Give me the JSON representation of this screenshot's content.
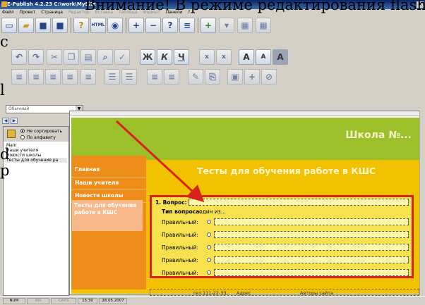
{
  "window": {
    "title": "E-Publish 4.2.23     C:\\work\\MySite"
  },
  "overlay": {
    "line1": "Внимание! В режиме редактирования flash",
    "line2_fragments": [
      "c",
      "l",
      "d",
      "p"
    ]
  },
  "menu": {
    "items": [
      "Файл",
      "Проект",
      "Страница",
      "Редактор",
      "Вставка",
      "Таблица",
      "Формат",
      "Панели",
      "?"
    ],
    "disabled": [
      "Редактор",
      "Вставка",
      "Таблица",
      "Формат"
    ]
  },
  "toolbar": {
    "html_label": "HTML",
    "bold": "Ж",
    "italic": "К",
    "underline": "Ч",
    "subscript": "x",
    "superscript": "x",
    "font_a": "A"
  },
  "style_select": {
    "value": "Обычный"
  },
  "sort": {
    "option1": "Не сортировать",
    "option2": "По алфавиту"
  },
  "pages": [
    "Main",
    "Наши учителя",
    "Новости школы",
    "Тесты для обучения ра"
  ],
  "site": {
    "title": "Школа №...",
    "page_heading": "Тесты для обучения работе в КШС",
    "nav": [
      "Главная",
      "Наши учителя",
      "Новости школы",
      "Тесты для обучения работе в КШС"
    ],
    "question_label": "1. Вопрос:",
    "type_label": "Тип вопроса:",
    "type_value": "один из...",
    "answer_label": "Правильный:",
    "footer_phone": "тел.111-22-33,",
    "footer_address": "Адрес",
    "footer_authors": "Авторы сайта"
  },
  "status": {
    "num": "NUM",
    "ins": "INS",
    "caps": "CAPS",
    "time": "15:30",
    "date": "28.05.2007"
  },
  "colors": {
    "green": "#9bc02a",
    "yellow": "#f2c200",
    "orange": "#ef8d1a",
    "highlight": "#d8231b"
  }
}
